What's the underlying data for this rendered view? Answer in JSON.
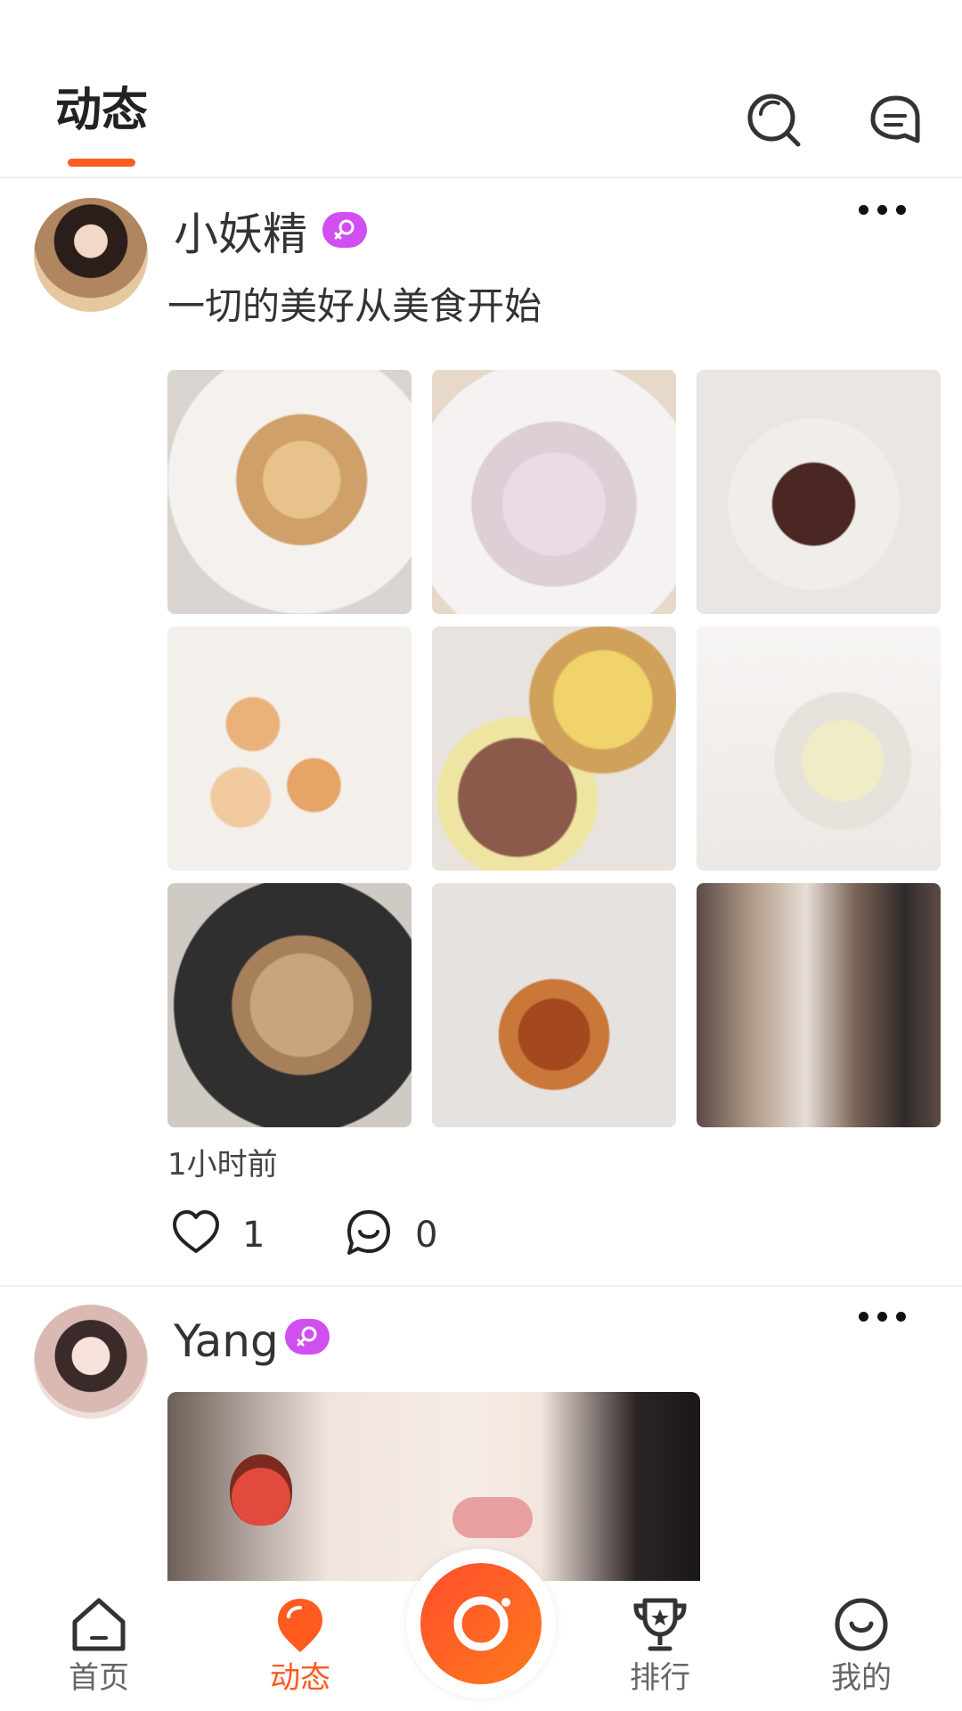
{
  "header": {
    "title": "动态",
    "search_icon": "search-icon",
    "message_icon": "message-icon"
  },
  "posts": [
    {
      "username": "小妖精",
      "gender": "female",
      "text": "一切的美好从美食开始",
      "time": "1小时前",
      "likes": "1",
      "comments": "0",
      "photo_count": 9
    },
    {
      "username": "Yang",
      "gender": "female",
      "media": "video"
    }
  ],
  "bottom_nav": {
    "items": [
      {
        "label": "首页",
        "icon": "home-icon",
        "active": false
      },
      {
        "label": "动态",
        "icon": "location-pin-icon",
        "active": true
      },
      {
        "label": "排行",
        "icon": "trophy-icon",
        "active": false
      },
      {
        "label": "我的",
        "icon": "smile-face-icon",
        "active": false
      }
    ],
    "camera_icon": "camera-icon"
  },
  "colors": {
    "accent": "#ff5a1f",
    "female_badge": "#d14ff0",
    "divider": "#eeeeee"
  }
}
